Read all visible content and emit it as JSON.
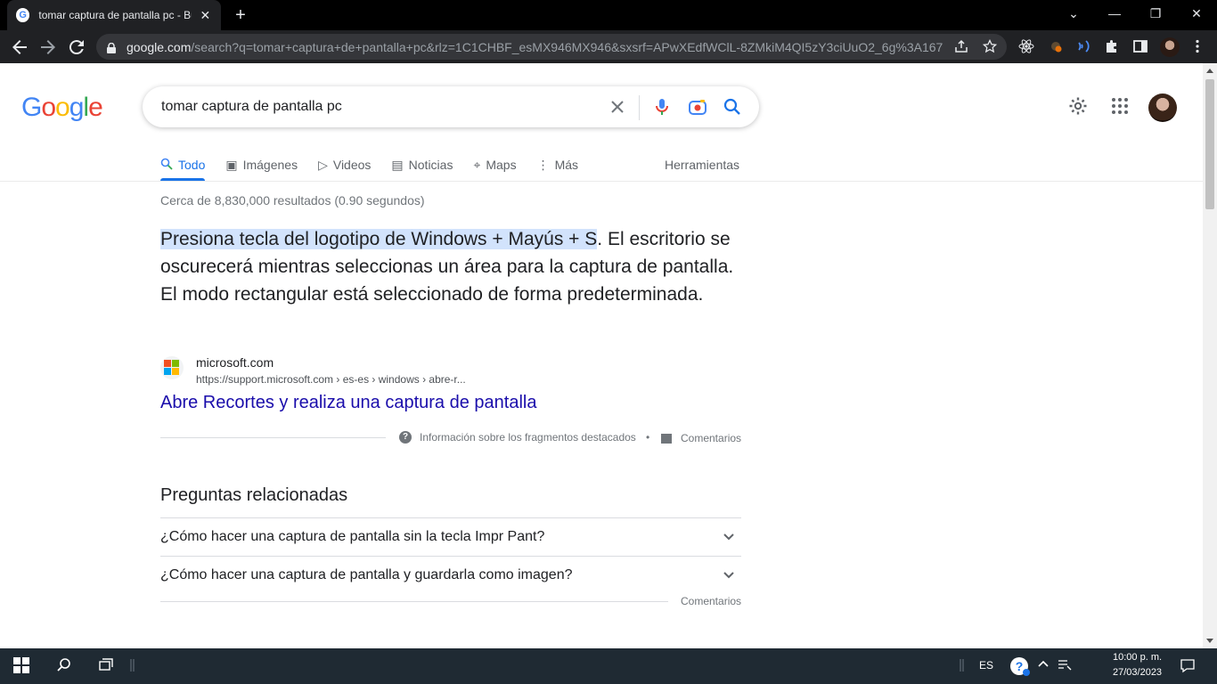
{
  "browser": {
    "tab_title": "tomar captura de pantalla pc - Bu",
    "tab_close": "✕",
    "new_tab": "+",
    "url_host": "google.com",
    "url_rest": "/search?q=tomar+captura+de+pantalla+pc&rlz=1C1CHBF_esMX946MX946&sxsrf=APwXEdfWClL-8ZMkiM4QI5zY3ciUuO2_6g%3A167...",
    "window_controls": [
      "⌄",
      "—",
      "❐",
      "✕"
    ]
  },
  "search": {
    "logo": [
      "G",
      "o",
      "o",
      "g",
      "l",
      "e"
    ],
    "logo_colors": [
      "#4285f4",
      "#ea4335",
      "#fbbc05",
      "#4285f4",
      "#34a853",
      "#ea4335"
    ],
    "query": "tomar captura de pantalla pc"
  },
  "tabs": [
    {
      "label": "Todo",
      "icon": "🔍"
    },
    {
      "label": "Imágenes",
      "icon": "▣"
    },
    {
      "label": "Videos",
      "icon": "▷"
    },
    {
      "label": "Noticias",
      "icon": "▤"
    },
    {
      "label": "Maps",
      "icon": "⌖"
    },
    {
      "label": "Más",
      "icon": "⋮"
    }
  ],
  "tools_label": "Herramientas",
  "results": {
    "stats": "Cerca de 8,830,000 resultados (0.90 segundos)",
    "snippet_highlight": "Presiona tecla del logotipo de Windows + Mayús + S",
    "snippet_rest": ". El escritorio se oscurecerá mientras seleccionas un área para la captura de pantalla. El modo rectangular está seleccionado de forma predeterminada.",
    "source_site": "microsoft.com",
    "source_cite": "https://support.microsoft.com › es-es › windows › abre-r...",
    "link_title": "Abre Recortes y realiza una captura de pantalla",
    "about_snippets": "Información sobre los fragmentos destacados",
    "separator": "•",
    "feedback": "Comentarios"
  },
  "paa": {
    "title": "Preguntas relacionadas",
    "questions": [
      "¿Cómo hacer una captura de pantalla sin la tecla Impr Pant?",
      "¿Cómo hacer una captura de pantalla y guardarla como imagen?"
    ],
    "feedback": "Comentarios"
  },
  "taskbar": {
    "lang": "ES",
    "time": "10:00 p. m.",
    "date": "27/03/2023"
  }
}
